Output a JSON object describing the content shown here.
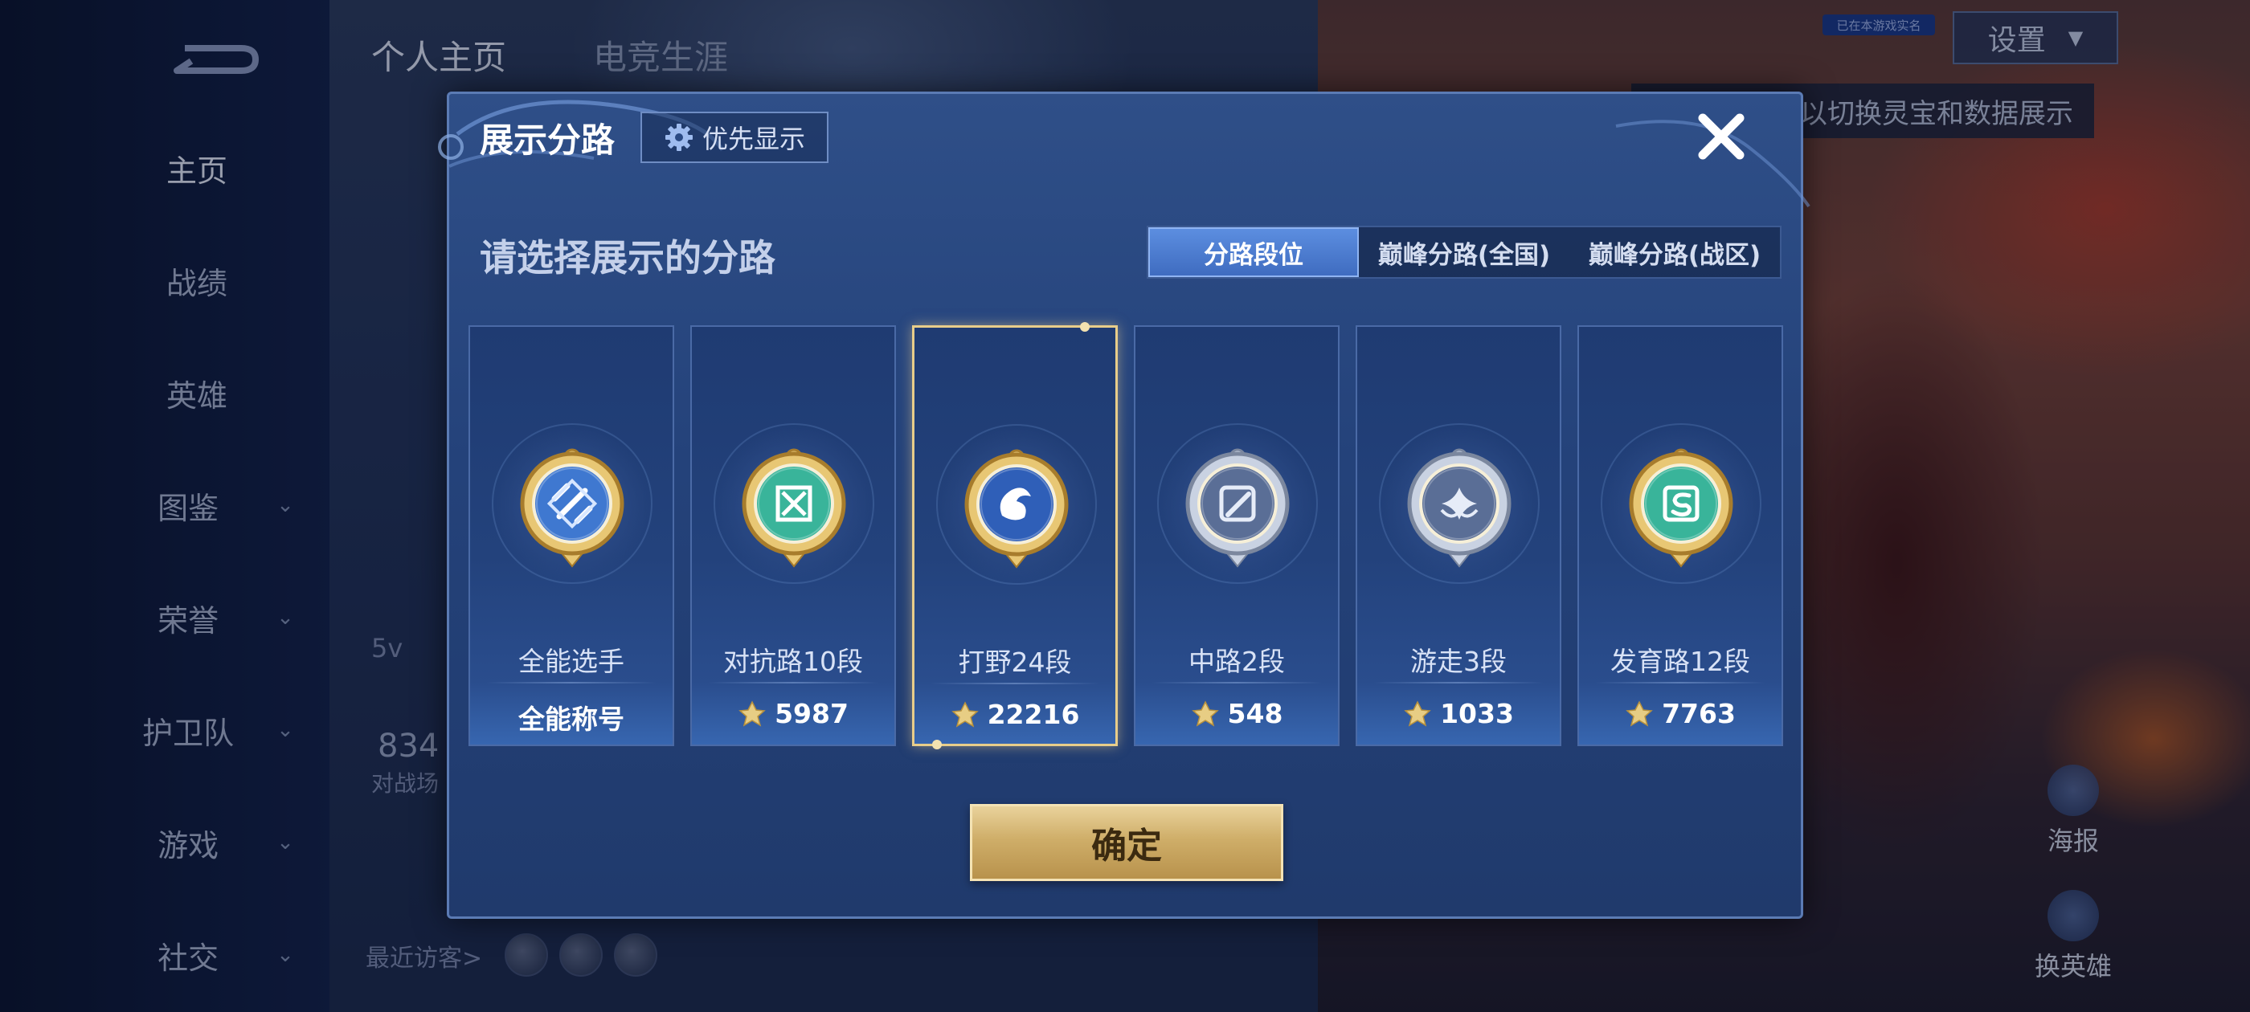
{
  "nav": {
    "items": [
      {
        "label": "主页",
        "active": true,
        "expandable": false
      },
      {
        "label": "战绩",
        "active": false,
        "expandable": false
      },
      {
        "label": "英雄",
        "active": false,
        "expandable": false
      },
      {
        "label": "图鉴",
        "active": false,
        "expandable": true
      },
      {
        "label": "荣誉",
        "active": false,
        "expandable": true
      },
      {
        "label": "护卫队",
        "active": false,
        "expandable": true
      },
      {
        "label": "游戏",
        "active": false,
        "expandable": true
      },
      {
        "label": "社交",
        "active": false,
        "expandable": true
      }
    ]
  },
  "top_tabs": [
    {
      "label": "个人主页",
      "active": true
    },
    {
      "label": "电竞生涯",
      "active": false
    }
  ],
  "settings": {
    "label": "设置",
    "badge": "已在本游戏实名"
  },
  "hint_text": "以切换灵宝和数据展示",
  "background_text": {
    "mode_fragment": "5v",
    "count_fragment": "834",
    "count_label_fragment": "对战场",
    "recent_visitors": "最近访客>"
  },
  "side_actions": [
    {
      "label": "海报"
    },
    {
      "label": "换英雄"
    }
  ],
  "modal": {
    "title": "展示分路",
    "priority_button": "优先显示",
    "subtitle": "请选择展示的分路",
    "tabs": [
      {
        "label": "分路段位",
        "active": true
      },
      {
        "label": "巅峰分路(全国)",
        "active": false
      },
      {
        "label": "巅峰分路(战区)",
        "active": false
      }
    ],
    "cards": [
      {
        "name": "全能选手",
        "value": "全能称号",
        "has_trophy": false,
        "selected": false,
        "emblem": "all-round-icon",
        "gem": "#d9b45a",
        "inner": "#3f78d0"
      },
      {
        "name": "对抗路10段",
        "value": "5987",
        "has_trophy": true,
        "selected": false,
        "emblem": "clash-lane-icon",
        "gem": "#d9b45a",
        "inner": "#39b49a"
      },
      {
        "name": "打野24段",
        "value": "22216",
        "has_trophy": true,
        "selected": true,
        "emblem": "jungle-icon",
        "gem": "#d9b45a",
        "inner": "#2f5fb8"
      },
      {
        "name": "中路2段",
        "value": "548",
        "has_trophy": true,
        "selected": false,
        "emblem": "mid-lane-icon",
        "gem": "#aab4c8",
        "inner": "#5a6e96"
      },
      {
        "name": "游走3段",
        "value": "1033",
        "has_trophy": true,
        "selected": false,
        "emblem": "roam-icon",
        "gem": "#aab4c8",
        "inner": "#5a6e96"
      },
      {
        "name": "发育路12段",
        "value": "7763",
        "has_trophy": true,
        "selected": false,
        "emblem": "farm-lane-icon",
        "gem": "#d9b45a",
        "inner": "#39b49a"
      }
    ],
    "confirm_button": "确定"
  },
  "colors": {
    "accent_gold": "#e8cd8a",
    "tab_active": "#4f80d6",
    "modal_bg": "#27457f"
  }
}
